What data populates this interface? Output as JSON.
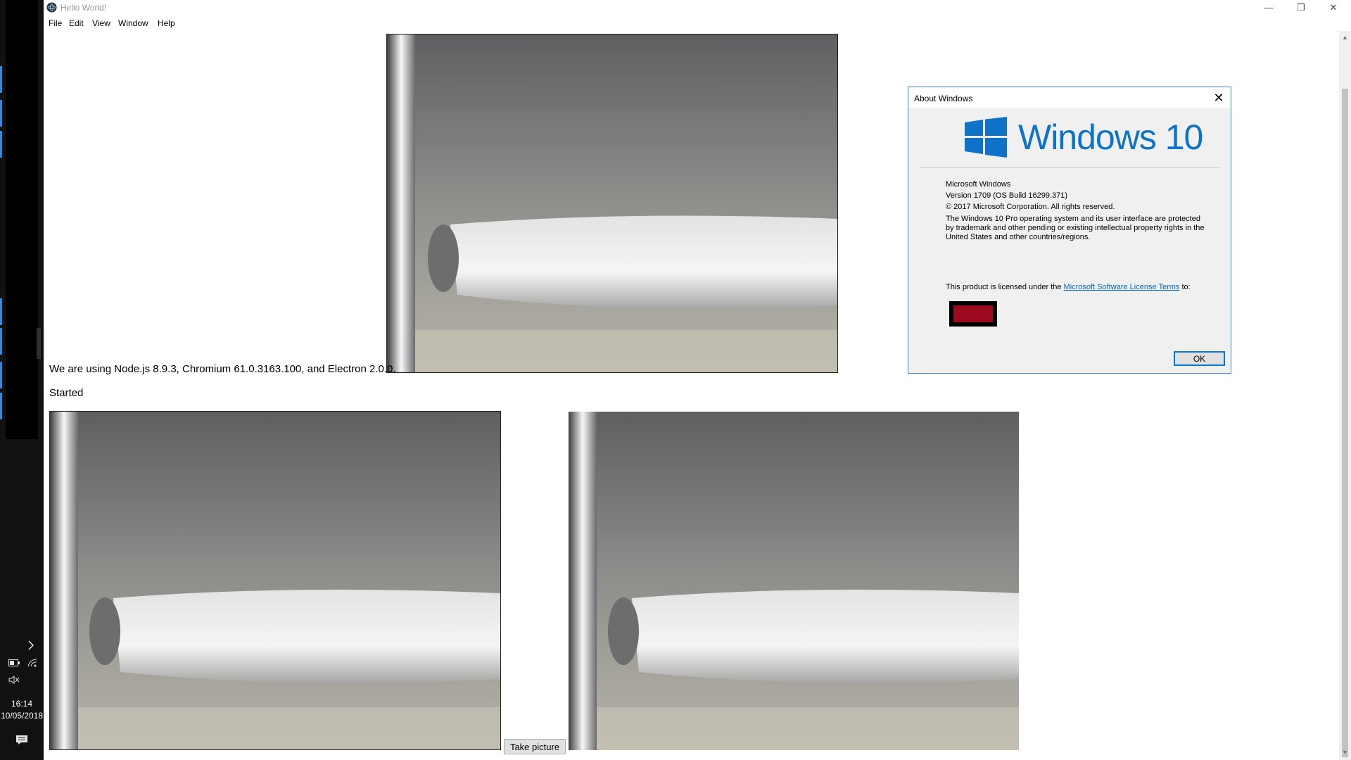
{
  "window": {
    "title": "Hello World!",
    "controls": {
      "minimize": "—",
      "restore": "❐",
      "close": "✕"
    }
  },
  "menu": [
    "File",
    "Edit",
    "View",
    "Window",
    "Help"
  ],
  "content": {
    "info": "We are using Node.js 8.9.3, Chromium 61.0.3163.100, and Electron 2.0.0.",
    "status": "Started",
    "take_picture": "Take picture"
  },
  "about": {
    "title": "About Windows",
    "close": "✕",
    "brand": "Windows 10",
    "product": "Microsoft Windows",
    "version": "Version 1709 (OS Build 16299.371)",
    "copyright": "© 2017 Microsoft Corporation. All rights reserved.",
    "legal": "The Windows 10 Pro operating system and its user interface are protected by trademark and other pending or existing intellectual property rights in the United States and other countries/regions.",
    "license_prefix": "This product is licensed under the ",
    "license_link": "Microsoft Software License Terms",
    "license_suffix": " to:",
    "ok": "OK"
  },
  "taskbar": {
    "time": "16:14",
    "date": "10/05/2018",
    "icons": [
      "chevron-right-icon",
      "battery-icon",
      "wifi-icon",
      "mute-icon",
      "notification-icon"
    ]
  },
  "colors": {
    "accent": "#0078d7",
    "brand_blue": "#0e73c8",
    "taskbar": "#111111",
    "licensee": "#9b0a1f"
  }
}
